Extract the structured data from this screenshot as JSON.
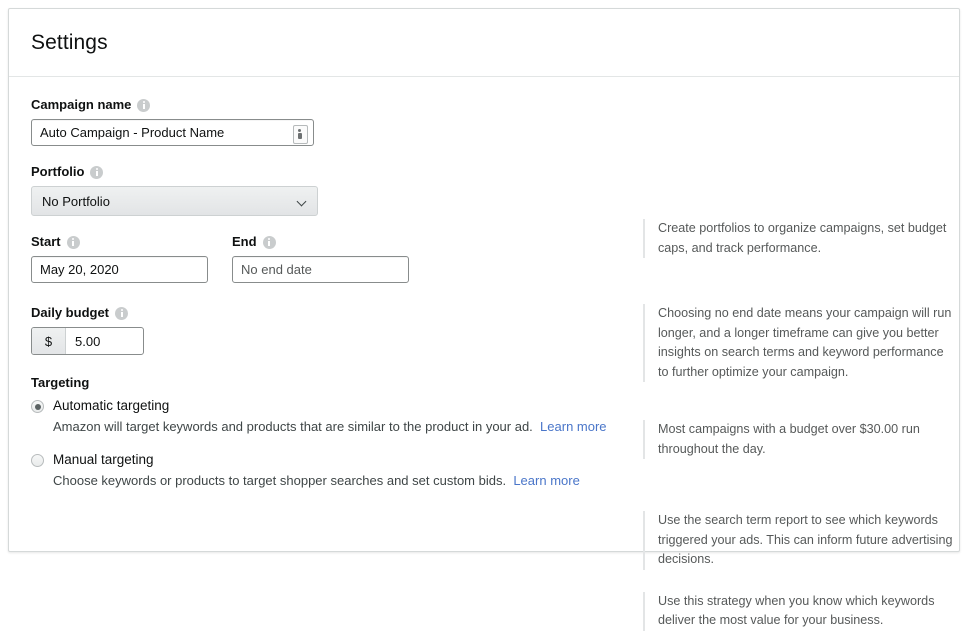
{
  "header": {
    "title": "Settings"
  },
  "form": {
    "campaign_name": {
      "label": "Campaign name",
      "value": "Auto Campaign - Product Name",
      "info_icon": "info-icon",
      "resize_icon": "resize-handle-icon"
    },
    "portfolio": {
      "label": "Portfolio",
      "selected": "No Portfolio",
      "info_icon": "info-icon",
      "chevron_icon": "chevron-down-icon"
    },
    "start": {
      "label": "Start",
      "value": "May 20, 2020",
      "info_icon": "info-icon"
    },
    "end": {
      "label": "End",
      "value": "No end date",
      "info_icon": "info-icon"
    },
    "daily_budget": {
      "label": "Daily budget",
      "currency_symbol": "$",
      "value": "5.00",
      "info_icon": "info-icon"
    },
    "targeting": {
      "title": "Targeting",
      "options": [
        {
          "label": "Automatic targeting",
          "description": "Amazon will target keywords and products that are similar to the product in your ad.",
          "link_text": "Learn more",
          "selected": true
        },
        {
          "label": "Manual targeting",
          "description": "Choose keywords or products to target shopper searches and set custom bids.",
          "link_text": "Learn more",
          "selected": false
        }
      ]
    }
  },
  "help": {
    "portfolio": "Create portfolios to organize campaigns, set budget caps, and track performance.",
    "dates": "Choosing no end date means your campaign will run longer, and a longer timeframe can give you better insights on search terms and keyword performance to further optimize your campaign.",
    "budget": "Most campaigns with a budget over $30.00 run throughout the day.",
    "automatic_targeting": "Use the search term report to see which keywords triggered your ads. This can inform future advertising decisions.",
    "manual_targeting": "Use this strategy when you know which keywords deliver the most value for your business."
  },
  "colors": {
    "link": "#4a76c9",
    "text_primary": "#0f1111",
    "text_secondary": "#565959",
    "border": "#d5d9d9"
  }
}
